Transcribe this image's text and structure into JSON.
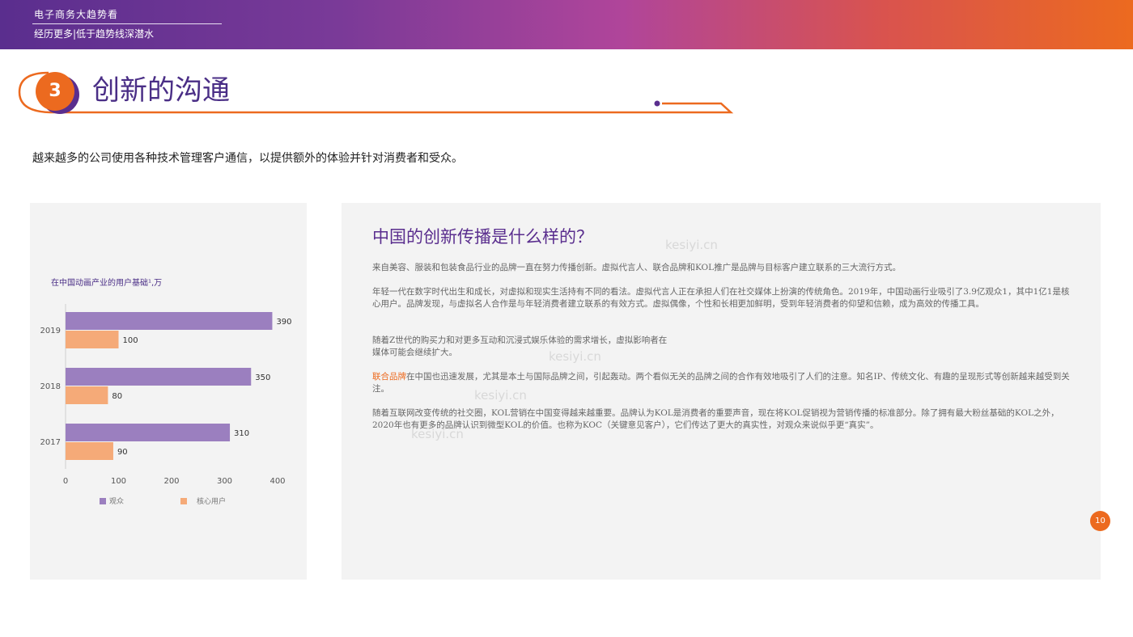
{
  "header": {
    "top_title": "电子商务大趋势看",
    "tagline": "经历更多|低于趋势线深潜水"
  },
  "section": {
    "number": "3",
    "title": "创新的沟通"
  },
  "intro": "越来越多的公司使用各种技术管理客户通信，以提供额外的体验并针对消费者和受众。",
  "chart_data": {
    "type": "bar",
    "orientation": "horizontal",
    "title": "在中国动画产业的用户基础¹,万",
    "categories": [
      "2019",
      "2018",
      "2017"
    ],
    "series": [
      {
        "name": "观众",
        "values": [
          390,
          350,
          310
        ],
        "color": "#9b7fbf"
      },
      {
        "name": "核心用户",
        "values": [
          100,
          80,
          90
        ],
        "color": "#f5aa78"
      }
    ],
    "xlim": [
      0,
      400
    ],
    "xticks": [
      "0",
      "100",
      "200",
      "300",
      "400"
    ],
    "legend_position": "bottom",
    "grid": false
  },
  "right_panel": {
    "heading": "中国的创新传播是什么样的？",
    "p1": "来自美容、服装和包装食品行业的品牌一直在努力传播创新。虚拟代言人、联合品牌和KOL推广是品牌与目标客户建立联系的三大流行方式。",
    "p2": "年轻一代在数字时代出生和成长，对虚拟和现实生活持有不同的看法。虚拟代言人正在承担人们在社交媒体上扮演的传统角色。2019年，中国动画行业吸引了3.9亿观众1，其中1亿1是核心用户。品牌发现，与虚拟名人合作是与年轻消费者建立联系的有效方式。虚拟偶像，个性和长相更加鲜明，受到年轻消费者的仰望和信赖，成为高效的传播工具。",
    "p3a": "随着Z世代的购买力和对更多互动和沉浸式娱乐体验的需求增长，虚拟影响者在",
    "p3b": "媒体可能会继续扩大。",
    "p4_highlight": "联合品牌",
    "p4_rest": "在中国也迅速发展，尤其是本土与国际品牌之间，引起轰动。两个看似无关的品牌之间的合作有效地吸引了人们的注意。知名IP、传统文化、有趣的呈现形式等创新越来越受到关注。",
    "p5": "随着互联网改变传统的社交圈，KOL营销在中国变得越来越重要。品牌认为KOL是消费者的重要声音，现在将KOL促销视为营销传播的标准部分。除了拥有最大粉丝基础的KOL之外，2020年也有更多的品牌认识到微型KOL的价值。也称为KOC（关键意见客户），它们传达了更大的真实性，对观众来说似乎更“真实”。"
  },
  "watermark": "kesiyi.cn",
  "page_number": "10",
  "colors": {
    "purple": "#5a2e8e",
    "orange": "#ec6a1f"
  }
}
